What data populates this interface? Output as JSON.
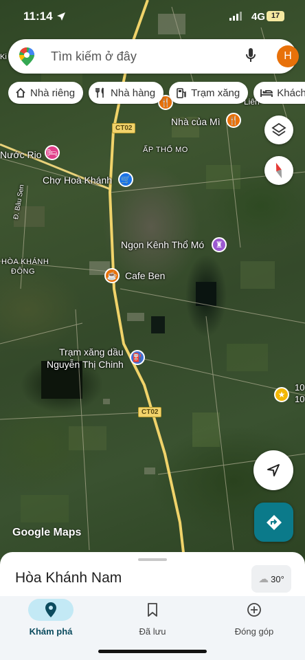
{
  "status_bar": {
    "time": "11:14",
    "network": "4G",
    "battery": "17"
  },
  "search": {
    "placeholder": "Tìm kiếm ở đây",
    "avatar_letter": "H"
  },
  "chips": [
    {
      "label": "Nhà riêng",
      "icon": "home-icon"
    },
    {
      "label": "Nhà hàng",
      "icon": "restaurant-icon"
    },
    {
      "label": "Trạm xăng",
      "icon": "gas-station-icon"
    },
    {
      "label": "Khách",
      "icon": "hotel-icon"
    }
  ],
  "map": {
    "road_shields": [
      "CT02",
      "CT02"
    ],
    "labels": {
      "nha_cua_mi": "Nhà của Mì",
      "ap_tho_mo": "ẤP THỔ MO",
      "nuoc_rio": "Nước Rio",
      "cho_hoa_khanh": "Chợ Hoà Khánh",
      "bau_sen": "Đ. Bàu Sen",
      "hoa_khanh_dong_1": "HÒA KHÁNH",
      "hoa_khanh_dong_2": "ĐÔNG",
      "ngon_kenh": "Ngọn Kênh Thổ Mó",
      "cafe_ben": "Cafe Ben",
      "tram_xang_1": "Trạm xăng dầu",
      "tram_xang_2": "Nguyễn Thị Chinh",
      "edge_1": "10",
      "edge_2": "10",
      "edge_top_right": "Liên",
      "edge_left": "Ki"
    },
    "attribution": "Google Maps"
  },
  "sheet": {
    "place_name": "Hòa Khánh Nam",
    "temperature": "30°"
  },
  "nav": [
    {
      "label": "Khám phá",
      "icon": "explore-pin-icon",
      "active": true
    },
    {
      "label": "Đã lưu",
      "icon": "bookmark-icon",
      "active": false
    },
    {
      "label": "Đóng góp",
      "icon": "add-circle-icon",
      "active": false
    }
  ],
  "colors": {
    "accent_teal": "#0b7a8a",
    "avatar_orange": "#e8710a",
    "active_pill": "#c3e9f5",
    "road_yellow": "#f2d36b"
  }
}
